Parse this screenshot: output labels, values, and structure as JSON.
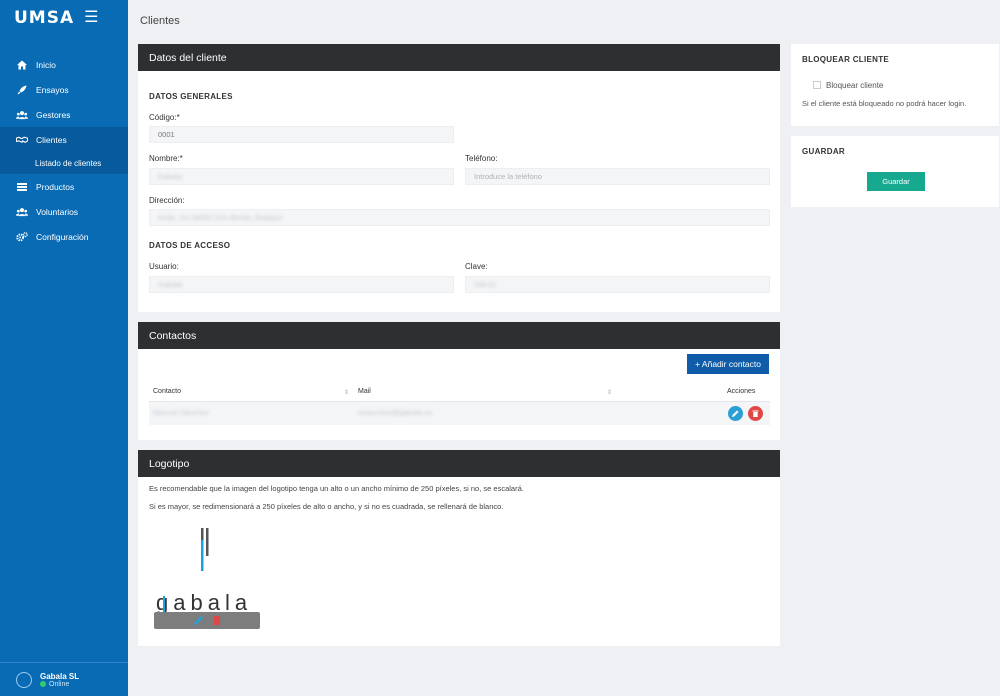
{
  "brand": {
    "logo": "UMSA",
    "menu_icon": "hamburger-icon"
  },
  "sidebar": {
    "items": [
      {
        "label": "Inicio",
        "icon": "home-icon"
      },
      {
        "label": "Ensayos",
        "icon": "rocket-icon"
      },
      {
        "label": "Gestores",
        "icon": "users-icon"
      },
      {
        "label": "Clientes",
        "icon": "handshake-icon",
        "active": true
      },
      {
        "label": "Productos",
        "icon": "list-icon"
      },
      {
        "label": "Voluntarios",
        "icon": "users-icon"
      },
      {
        "label": "Configuración",
        "icon": "gears-icon"
      }
    ],
    "sub_item": "Listado de clientes",
    "user": {
      "name": "Gabala SL",
      "status": "Online"
    }
  },
  "page": {
    "title": "Clientes"
  },
  "client_panel": {
    "title": "Datos del cliente",
    "general_label": "DATOS GENERALES",
    "codigo_label": "Código:*",
    "codigo_value": "0001",
    "nombre_label": "Nombre:*",
    "nombre_value": "Gabala",
    "telefono_label": "Teléfono:",
    "telefono_placeholder": "Introduce la teléfono",
    "direccion_label": "Dirección:",
    "direccion_value": "Avda. s/n 06800 Don Benito, Badajoz",
    "acceso_label": "DATOS DE ACCESO",
    "usuario_label": "Usuario:",
    "usuario_value": "Gabala",
    "clave_label": "Clave:",
    "clave_value": "Gbl-01"
  },
  "contacts_panel": {
    "title": "Contactos",
    "add_button": "+ Añadir contacto",
    "columns": {
      "contacto": "Contacto",
      "mail": "Mail",
      "acciones": "Acciones"
    },
    "rows": [
      {
        "contacto": "Manuel Sánchez",
        "mail": "msanchez@gabala.es"
      }
    ]
  },
  "logo_panel": {
    "title": "Logotipo",
    "note1": "Es recomendable que la imagen del logotipo tenga un alto o un ancho mínimo de 250 píxeles, si no, se escalará.",
    "note2": "Si es mayor, se redimensionará a 250 píxeles de alto o ancho, y si no es cuadrada, se rellenará de blanco.",
    "logo_text": "gabala"
  },
  "block_panel": {
    "title": "BLOQUEAR CLIENTE",
    "checkbox_label": "Bloquear cliente",
    "help": "Si el cliente está bloqueado no podrá hacer login."
  },
  "save_panel": {
    "title": "GUARDAR",
    "button": "Guardar"
  },
  "colors": {
    "sidebar": "#0a6bb5",
    "panel_header": "#2d2f30",
    "primary_button": "#0f5da8",
    "save_button": "#17a98f",
    "edit_button": "#2a9fd6",
    "delete_button": "#e04848"
  }
}
